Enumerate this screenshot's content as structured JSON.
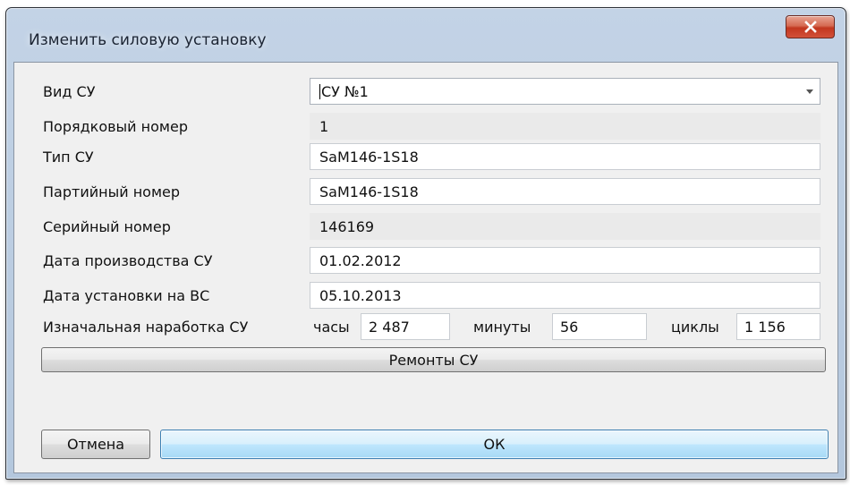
{
  "window": {
    "title": "Изменить силовую установку"
  },
  "form": {
    "vid_su": {
      "label": "Вид СУ",
      "value": "СУ №1"
    },
    "poryadkovy_nomer": {
      "label": "Порядковый номер",
      "value": "1"
    },
    "tip_su": {
      "label": "Тип СУ",
      "value": "SaM146-1S18"
    },
    "partiyny_nomer": {
      "label": "Партийный номер",
      "value": "SaM146-1S18"
    },
    "seriyny_nomer": {
      "label": "Серийный номер",
      "value": "146169"
    },
    "data_proizvodstva": {
      "label": "Дата производства СУ",
      "value": "01.02.2012"
    },
    "data_ustanovki": {
      "label": "Дата установки на ВС",
      "value": "05.10.2013"
    },
    "narabotka": {
      "label": "Изначальная наработка СУ",
      "hours_label": "часы",
      "hours_value": "2 487",
      "minutes_label": "минуты",
      "minutes_value": "56",
      "cycles_label": "циклы",
      "cycles_value": "1 156"
    }
  },
  "buttons": {
    "repairs": "Ремонты СУ",
    "cancel": "Отмена",
    "ok": "ОК"
  }
}
